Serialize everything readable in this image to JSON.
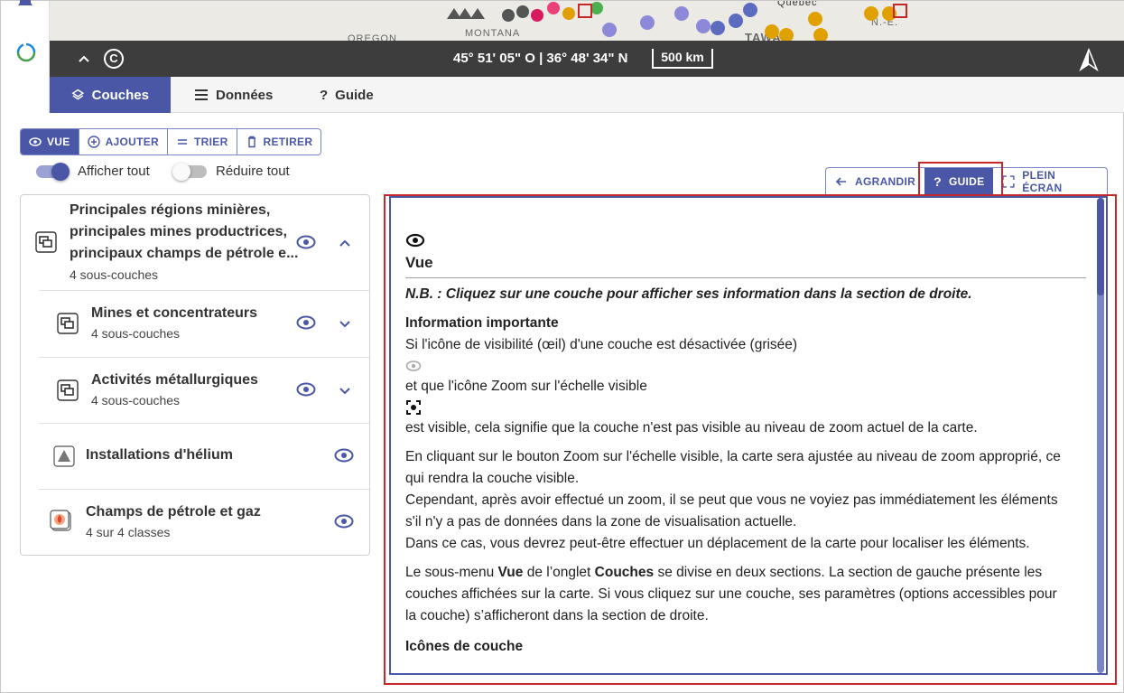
{
  "map": {
    "labels": [
      "OREGON",
      "MONTANA",
      "TAWA",
      "Québec",
      "N.-É."
    ],
    "coords": "45° 51' 05\" O | 36° 48' 34\" N",
    "scale": "500 km",
    "copyright_symbol": "C"
  },
  "tabs": [
    {
      "label": "Couches",
      "icon": "layers-icon",
      "active": true
    },
    {
      "label": "Données",
      "icon": "list-icon",
      "active": false
    },
    {
      "label": "Guide",
      "icon": "question-icon",
      "active": false
    }
  ],
  "subnav": [
    {
      "label": "VUE",
      "icon": "eye-icon",
      "active": true
    },
    {
      "label": "AJOUTER",
      "icon": "plus-circle-icon",
      "active": false
    },
    {
      "label": "TRIER",
      "icon": "sort-icon",
      "active": false
    },
    {
      "label": "RETIRER",
      "icon": "trash-icon",
      "active": false
    }
  ],
  "toggles": {
    "show_all": {
      "label": "Afficher tout",
      "on": true
    },
    "collapse_all": {
      "label": "Réduire tout",
      "on": false
    }
  },
  "layers": [
    {
      "title": "Principales régions minières, principales mines productrices, principaux champs de pétrole e...",
      "title_lines": [
        "Principales régions minières,",
        "principales mines productrices,",
        "principaux champs de pétrole e..."
      ],
      "subtitle": "4 sous-couches",
      "expanded": true
    },
    {
      "title": "Mines et concentrateurs",
      "subtitle": "4 sous-couches",
      "expanded": false
    },
    {
      "title": "Activités métallurgiques",
      "subtitle": "4 sous-couches",
      "expanded": false
    },
    {
      "title": "Installations d'hélium",
      "subtitle": ""
    },
    {
      "title": "Champs de pétrole et gaz",
      "subtitle": "4 sur 4 classes"
    }
  ],
  "right_buttons": [
    {
      "label": "AGRANDIR",
      "icon": "arrow-left-icon",
      "active": false
    },
    {
      "label": "GUIDE",
      "icon": "question-icon",
      "active": true
    },
    {
      "label": "PLEIN ÉCRAN",
      "icon": "fullscreen-icon",
      "active": false
    }
  ],
  "guide": {
    "heading": "Vue",
    "note": "N.B. : Cliquez sur une couche pour afficher ses information dans la section de droite.",
    "important_title": "Information importante",
    "line1": "Si l'icône de visibilité (œil) d'une couche est désactivée (grisée)",
    "line2": "et que l'icône Zoom sur l'échelle visible",
    "line3": "est visible, cela signifie que la couche n'est pas visible au niveau de zoom actuel de la carte.",
    "para2_line1": "En cliquant sur le bouton Zoom sur l'échelle visible, la carte sera ajustée au niveau de zoom approprié, ce",
    "para2_line2": "qui rendra la couche visible.",
    "para2_line3": "Cependant, après avoir effectué un zoom, il se peut que vous ne voyiez pas immédiatement les éléments",
    "para2_line4": "s'il n'y a pas de données dans la zone de visualisation actuelle.",
    "para2_line5": "Dans ce cas, vous devrez peut-être effectuer un déplacement de la carte pour localiser les éléments.",
    "para3_a": "Le sous-menu ",
    "para3_b": "Vue",
    "para3_c": " de l’onglet ",
    "para3_d": "Couches",
    "para3_e": " se divise en deux sections. La section de gauche présente les",
    "para3_line2": "couches affichées sur la carte. Si vous cliquez sur une couche, ses paramètres (options accessibles pour",
    "para3_line3": "la couche) s’afficheront dans la section de droite.",
    "icons_title": "Icônes de couche"
  },
  "colors": {
    "accent": "#4a57a7",
    "highlight": "#c62828",
    "mapbar": "#3d3d3d"
  }
}
